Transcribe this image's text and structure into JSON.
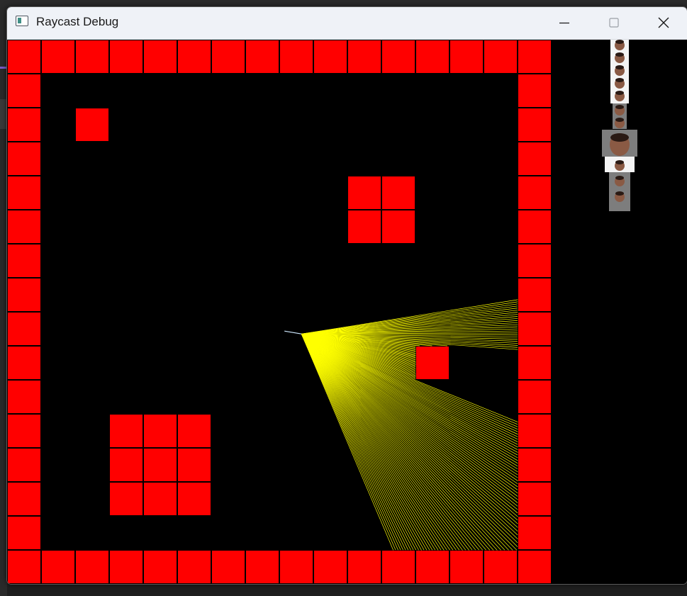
{
  "window": {
    "title": "Raycast Debug",
    "icons": {
      "app": "window-app-icon",
      "minimize": "minimize-icon",
      "maximize": "maximize-icon",
      "close": "close-icon"
    }
  },
  "map": {
    "rows": 16,
    "cols": 16,
    "wall_color": "#ff0000",
    "floor_color": "#000000",
    "grid": [
      "1111111111111111",
      "1000000000000001",
      "1010000000000001",
      "1000000000000001",
      "1000000000110001",
      "1000000000110001",
      "1000000000000001",
      "1000000000000001",
      "1000000000000001",
      "1000000000001001",
      "1000000000000001",
      "1001110000000001",
      "1001110000000001",
      "1001110000000001",
      "1000000000000001",
      "1111111111111111"
    ]
  },
  "player": {
    "col": 8.65,
    "row": 8.65,
    "heading_deg": 29,
    "ray_count": 140,
    "fov_deg": 76,
    "ray_color": "#ffff00"
  },
  "sprite_preview": {
    "label": "face-texture-sprite",
    "primary_color": "#f4f4f4",
    "secondary_color": "#7d7d7d"
  }
}
